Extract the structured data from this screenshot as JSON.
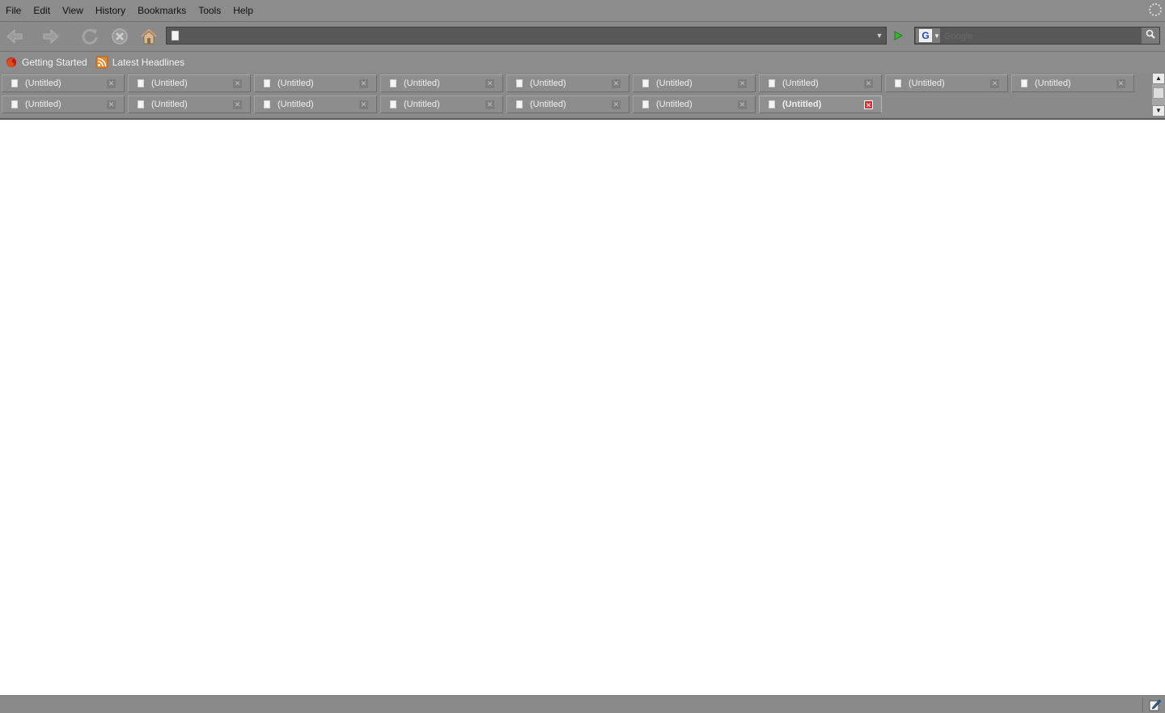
{
  "menu": {
    "items": [
      "File",
      "Edit",
      "View",
      "History",
      "Bookmarks",
      "Tools",
      "Help"
    ]
  },
  "navbar": {
    "url_value": "",
    "search_engine": "G",
    "search_placeholder": "Google"
  },
  "bookmarks": {
    "items": [
      {
        "label": "Getting Started",
        "icon": "firefox-icon"
      },
      {
        "label": "Latest Headlines",
        "icon": "rss-feed-icon"
      }
    ]
  },
  "tabs": {
    "row1": [
      "(Untitled)",
      "(Untitled)",
      "(Untitled)",
      "(Untitled)",
      "(Untitled)",
      "(Untitled)",
      "(Untitled)",
      "(Untitled)",
      "(Untitled)"
    ],
    "row2": [
      "(Untitled)",
      "(Untitled)",
      "(Untitled)",
      "(Untitled)",
      "(Untitled)",
      "(Untitled)",
      "(Untitled)"
    ],
    "selected_row": 2,
    "selected_index": 6
  },
  "status": {
    "text": ""
  },
  "colors": {
    "chrome": "#8c8c8c",
    "url_field": "#585858",
    "close_active": "#d83030",
    "go_arrow": "#39b239"
  }
}
